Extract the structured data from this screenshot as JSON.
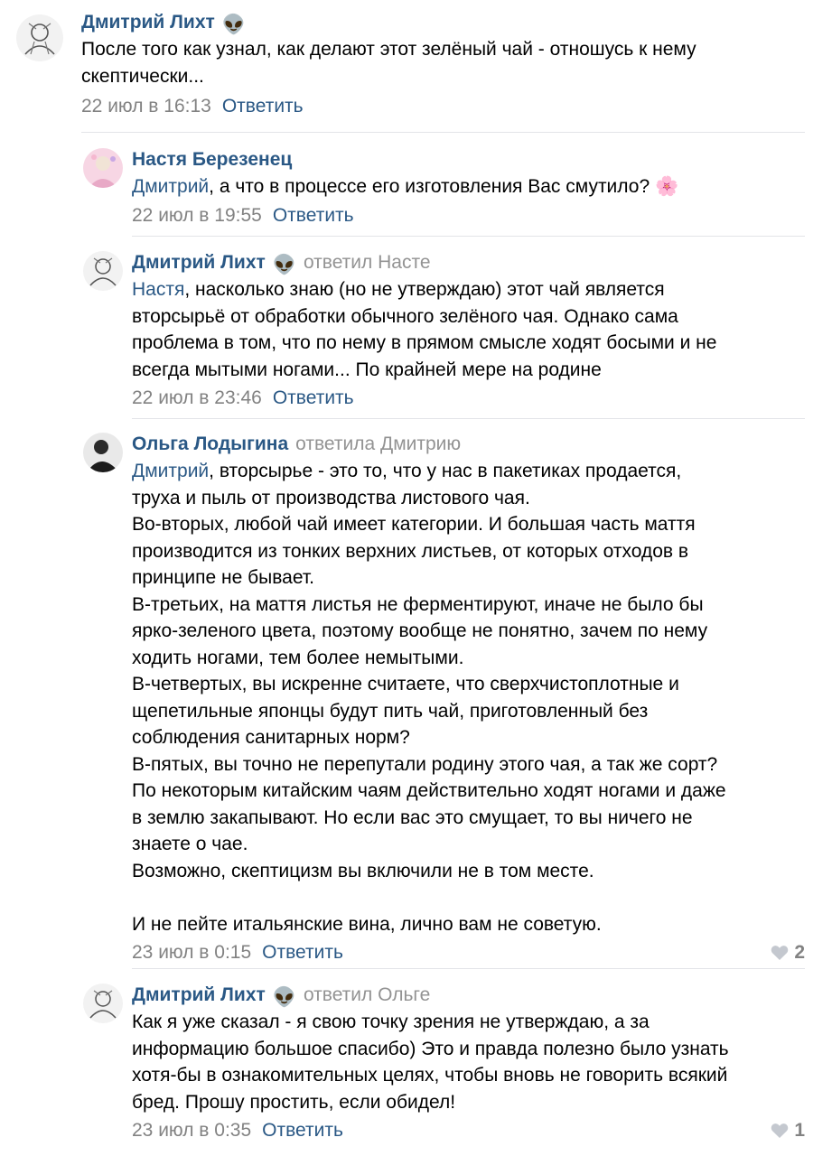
{
  "comments": [
    {
      "author": "Дмитрий Лихт",
      "author_emoji": "👽",
      "reply_to": "",
      "mention": "",
      "text": "После того как узнал, как делают этот зелёный чай - отношусь к нему\nскептически...",
      "date": "22 июл в 16:13",
      "reply_label": "Ответить",
      "likes": ""
    },
    {
      "author": "Настя Березенец",
      "author_emoji": "",
      "reply_to": "",
      "mention": "Дмитрий",
      "text": ", а что в процессе его изготовления Вас смутило? 🌸",
      "date": "22 июл в 19:55",
      "reply_label": "Ответить",
      "likes": ""
    },
    {
      "author": "Дмитрий Лихт",
      "author_emoji": "👽",
      "reply_to": "ответил Насте",
      "mention": "Настя",
      "text": ", насколько знаю (но не утверждаю) этот чай является\nвторсырьё от обработки обычного зелёного чая. Однако сама\nпроблема в том, что по нему в прямом смысле ходят босыми и не\nвсегда мытыми ногами... По крайней мере на родине",
      "date": "22 июл в 23:46",
      "reply_label": "Ответить",
      "likes": ""
    },
    {
      "author": "Ольга Лодыгина",
      "author_emoji": "",
      "reply_to": "ответила Дмитрию",
      "mention": "Дмитрий",
      "text": ", вторсырье - это то, что у нас в пакетиках продается,\nтруха и пыль от производства листового чая.\nВо-вторых, любой чай имеет категории. И большая часть маття\nпроизводится из тонких верхних листьев, от которых отходов в\nпринципе не бывает.\nВ-третьих, на маття листья не ферментируют, иначе не было бы\nярко-зеленого цвета, поэтому вообще не понятно, зачем по нему\nходить ногами, тем более немытыми.\nВ-четвертых, вы искренне считаете, что сверхчистоплотные и\nщепетильные японцы будут пить чай, приготовленный без\nсоблюдения санитарных норм?\nВ-пятых, вы точно не перепутали родину этого чая, а так же сорт?\nПо некоторым китайским чаям действительно ходят ногами и даже\nв землю закапывают. Но если вас это смущает, то вы ничего не\nзнаете о чае.\nВозможно, скептицизм вы включили не в том месте.\n\nИ не пейте итальянские вина, лично вам не советую.",
      "date": "23 июл в 0:15",
      "reply_label": "Ответить",
      "likes": "2"
    },
    {
      "author": "Дмитрий Лихт",
      "author_emoji": "👽",
      "reply_to": "ответил Ольге",
      "mention": "",
      "text": "Как я уже сказал - я свою точку зрения не утверждаю, а за\nинформацию большое спасибо) Это и правда полезно было узнать\nхотя-бы в ознакомительных целях, чтобы вновь не говорить всякий\nбред. Прошу простить, если обидел!",
      "date": "23 июл в 0:35",
      "reply_label": "Ответить",
      "likes": "1"
    }
  ],
  "colors": {
    "link": "#2a5885",
    "meta": "#828282",
    "divider": "#e3e4e8"
  }
}
